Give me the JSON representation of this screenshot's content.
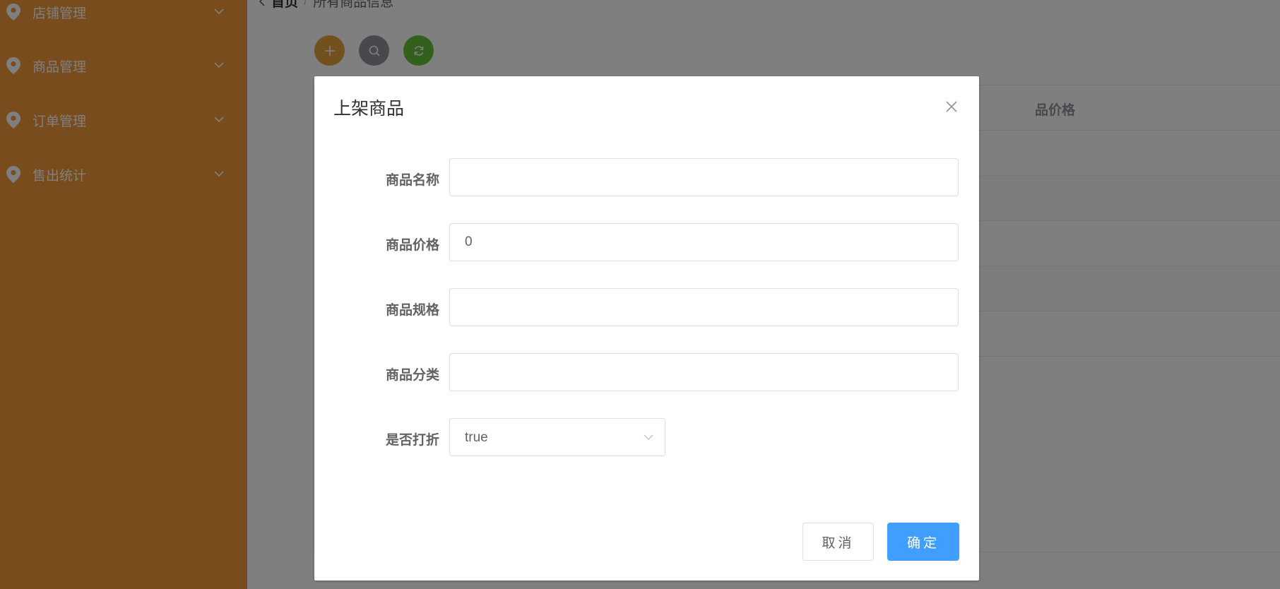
{
  "sidebar": {
    "items": [
      {
        "label": "店铺管理",
        "icon": "location-pin-icon"
      },
      {
        "label": "商品管理",
        "icon": "location-pin-icon"
      },
      {
        "label": "订单管理",
        "icon": "location-pin-icon"
      },
      {
        "label": "售出统计",
        "icon": "location-pin-icon"
      }
    ]
  },
  "breadcrumb": {
    "home": "首页",
    "separator": "/",
    "current": "所有商品信息"
  },
  "toolbar": {
    "add_icon": "plus-icon",
    "search_icon": "search-icon",
    "refresh_icon": "refresh-icon",
    "colors": {
      "add": "#e6a23c",
      "search": "#909399",
      "refresh": "#67c23a"
    }
  },
  "table": {
    "visible_header": "品价格"
  },
  "dialog": {
    "title": "上架商品",
    "fields": [
      {
        "label": "商品名称",
        "value": "",
        "placeholder": ""
      },
      {
        "label": "商品价格",
        "value": "0",
        "placeholder": ""
      },
      {
        "label": "商品规格",
        "value": "",
        "placeholder": ""
      },
      {
        "label": "商品分类",
        "value": "",
        "placeholder": ""
      }
    ],
    "discount": {
      "label": "是否打折",
      "value": "true"
    },
    "cancel_label": "取消",
    "ok_label": "确定"
  },
  "colors": {
    "sidebar_bg": "#f0993a",
    "primary": "#409eff"
  }
}
